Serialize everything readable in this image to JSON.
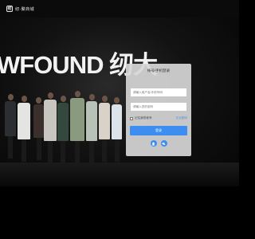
{
  "app": {
    "logo_mark": "纫",
    "logo_text": "纫·聚商城"
  },
  "hero": {
    "brand_text": "WFOUND 纫大"
  },
  "login": {
    "title": "帐号/手机登录",
    "username_placeholder": "请输入用户名/手机号码",
    "password_placeholder": "请输入您的密码",
    "remember_label": "记住我的帐号",
    "forgot_label": "忘记密码",
    "submit_label": "登录"
  },
  "social": [
    {
      "name": "qq-icon"
    },
    {
      "name": "wechat-icon"
    }
  ],
  "colors": {
    "accent": "#3d8ef0",
    "panel": "#d7d7d7",
    "background": "#000000"
  }
}
